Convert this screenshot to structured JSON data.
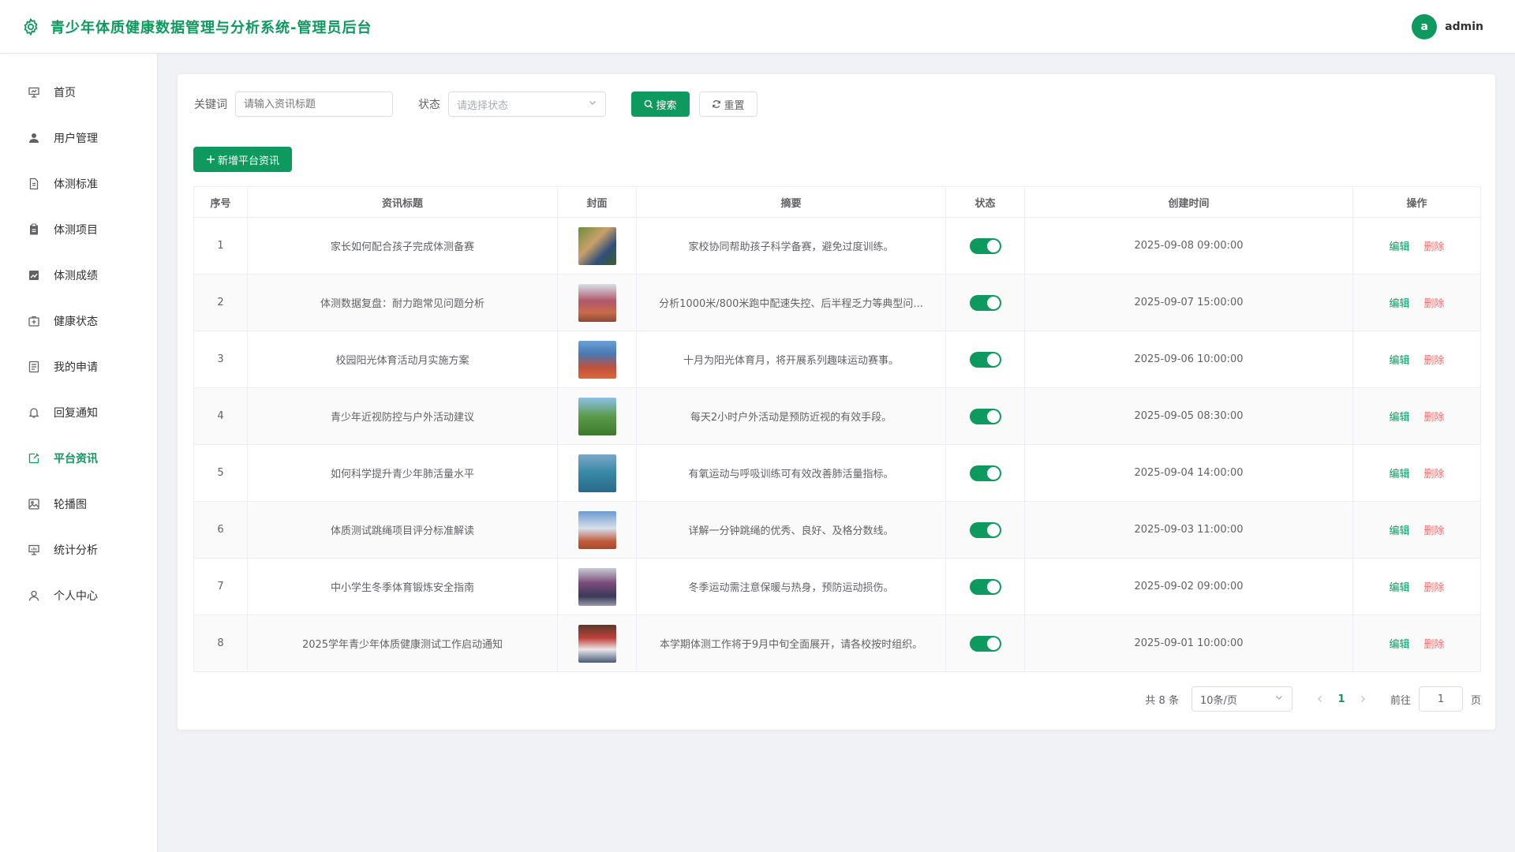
{
  "header": {
    "title": "青少年体质健康数据管理与分析系统-管理员后台",
    "avatar_letter": "a",
    "username": "admin"
  },
  "sidebar": {
    "items": [
      {
        "label": "首页",
        "icon": "presentation-icon"
      },
      {
        "label": "用户管理",
        "icon": "user-icon"
      },
      {
        "label": "体测标准",
        "icon": "document-icon"
      },
      {
        "label": "体测项目",
        "icon": "clipboard-icon"
      },
      {
        "label": "体测成绩",
        "icon": "chart-icon"
      },
      {
        "label": "健康状态",
        "icon": "medical-box-icon"
      },
      {
        "label": "我的申请",
        "icon": "form-icon"
      },
      {
        "label": "回复通知",
        "icon": "bell-icon"
      },
      {
        "label": "平台资讯",
        "icon": "news-icon",
        "active": true
      },
      {
        "label": "轮播图",
        "icon": "picture-icon"
      },
      {
        "label": "统计分析",
        "icon": "data-board-icon"
      },
      {
        "label": "个人中心",
        "icon": "user-outline-icon"
      }
    ]
  },
  "filters": {
    "keyword_label": "关键词",
    "keyword_placeholder": "请输入资讯标题",
    "status_label": "状态",
    "status_placeholder": "请选择状态",
    "search_label": "搜索",
    "reset_label": "重置"
  },
  "add_button_label": "新增平台资讯",
  "table": {
    "columns": [
      "序号",
      "资讯标题",
      "封面",
      "摘要",
      "状态",
      "创建时间",
      "操作"
    ],
    "rows": [
      {
        "index": "1",
        "title": "家长如何配合孩子完成体测备赛",
        "summary": "家校协同帮助孩子科学备赛，避免过度训练。",
        "status_on": true,
        "created": "2025-09-08 09:00:00"
      },
      {
        "index": "2",
        "title": "体测数据复盘：耐力跑常见问题分析",
        "summary": "分析1000米/800米跑中配速失控、后半程乏力等典型问...",
        "status_on": true,
        "created": "2025-09-07 15:00:00"
      },
      {
        "index": "3",
        "title": "校园阳光体育活动月实施方案",
        "summary": "十月为阳光体育月，将开展系列趣味运动赛事。",
        "status_on": true,
        "created": "2025-09-06 10:00:00"
      },
      {
        "index": "4",
        "title": "青少年近视防控与户外活动建议",
        "summary": "每天2小时户外活动是预防近视的有效手段。",
        "status_on": true,
        "created": "2025-09-05 08:30:00"
      },
      {
        "index": "5",
        "title": "如何科学提升青少年肺活量水平",
        "summary": "有氧运动与呼吸训练可有效改善肺活量指标。",
        "status_on": true,
        "created": "2025-09-04 14:00:00"
      },
      {
        "index": "6",
        "title": "体质测试跳绳项目评分标准解读",
        "summary": "详解一分钟跳绳的优秀、良好、及格分数线。",
        "status_on": true,
        "created": "2025-09-03 11:00:00"
      },
      {
        "index": "7",
        "title": "中小学生冬季体育锻炼安全指南",
        "summary": "冬季运动需注意保暖与热身，预防运动损伤。",
        "status_on": true,
        "created": "2025-09-02 09:00:00"
      },
      {
        "index": "8",
        "title": "2025学年青少年体质健康测试工作启动通知",
        "summary": "本学期体测工作将于9月中旬全面展开，请各校按时组织。",
        "status_on": true,
        "created": "2025-09-01 10:00:00"
      }
    ],
    "edit_label": "编辑",
    "delete_label": "删除"
  },
  "pagination": {
    "total_text": "共 8 条",
    "page_size": "10条/页",
    "current_page": "1",
    "goto_label": "前往",
    "goto_value": "1",
    "page_suffix": "页"
  },
  "colors": {
    "brand": "#0e9a5e",
    "danger": "#f56c6c"
  }
}
